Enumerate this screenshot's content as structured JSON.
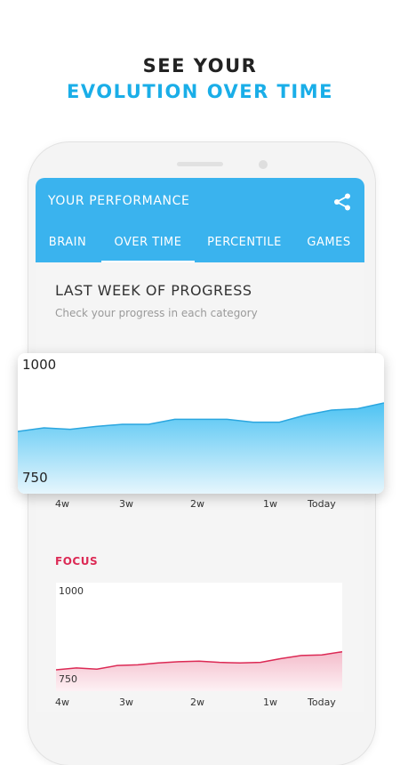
{
  "promo": {
    "line1": "SEE YOUR",
    "line2": "EVOLUTION OVER TIME"
  },
  "appbar": {
    "title": "YOUR PERFORMANCE",
    "share_icon": "share-icon",
    "color": "#3ab3ee"
  },
  "tabs": [
    {
      "label": "BRAIN",
      "active": false
    },
    {
      "label": "OVER TIME",
      "active": true
    },
    {
      "label": "PERCENTILE",
      "active": false
    },
    {
      "label": "GAMES",
      "active": false
    }
  ],
  "section": {
    "title": "LAST WEEK OF PROGRESS",
    "subtitle": "Check your progress in each category"
  },
  "x_labels": [
    "4w",
    "3w",
    "2w",
    "1w",
    "Today"
  ],
  "focus": {
    "title": "FOCUS",
    "color": "#dc2a55"
  },
  "chart_data": [
    {
      "type": "area",
      "title": "",
      "x": [
        "4w",
        "",
        "",
        "3w",
        "",
        "",
        "2w",
        "",
        "",
        "",
        "1w",
        "",
        "",
        "",
        "Today"
      ],
      "series": [
        {
          "values": [
            890,
            895,
            893,
            897,
            900,
            900,
            907,
            907,
            907,
            903,
            903,
            913,
            920,
            922,
            930
          ]
        }
      ],
      "ylim": [
        750,
        1000
      ],
      "ytick_labels": [
        "1000",
        "750"
      ],
      "color": "#3ab3ee"
    },
    {
      "type": "area",
      "title": "FOCUS",
      "x": [
        "4w",
        "",
        "",
        "3w",
        "",
        "",
        "2w",
        "",
        "",
        "",
        "1w",
        "",
        "",
        "",
        "Today"
      ],
      "series": [
        {
          "values": [
            860,
            863,
            861,
            867,
            868,
            871,
            873,
            874,
            872,
            871,
            872,
            878,
            883,
            884,
            889
          ]
        }
      ],
      "ylim": [
        750,
        1000
      ],
      "ytick_labels": [
        "1000",
        "750"
      ],
      "color": "#dc2a55"
    }
  ]
}
